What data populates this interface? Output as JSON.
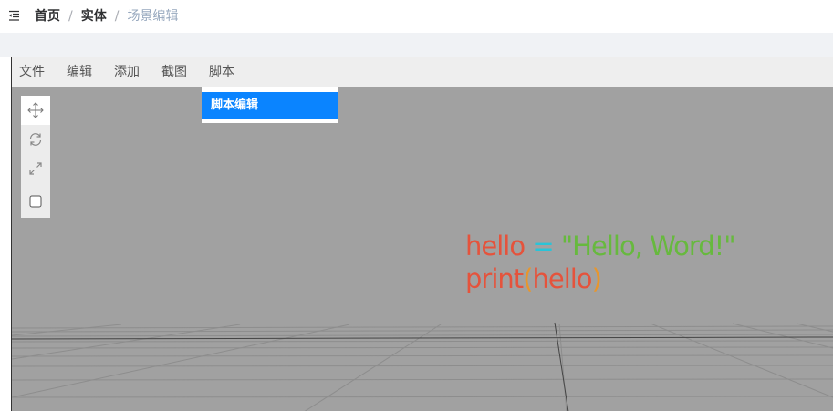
{
  "header": {
    "menu_icon": "outdent-icon",
    "breadcrumb": [
      "首页",
      "实体",
      "场景编辑"
    ],
    "separator": "/"
  },
  "menubar": {
    "items": [
      "文件",
      "编辑",
      "添加",
      "截图",
      "脚本"
    ],
    "open_menu": "脚本",
    "dropdown_items": [
      "脚本编辑"
    ]
  },
  "toolbar": {
    "tools": [
      "move-icon",
      "rotate-icon",
      "scale-icon",
      "checkbox-icon"
    ],
    "active_tool": "move-icon"
  },
  "scene_code": {
    "line1": {
      "var": "hello",
      "op": "=",
      "str": "\"Hello, Word!\""
    },
    "line2": {
      "fn": "print",
      "open": "(",
      "arg": "hello",
      "close": ")"
    }
  },
  "colors": {
    "accent": "#0a84ff",
    "viewport_bg": "#a1a1a1",
    "code_red": "#e5533c",
    "code_cyan": "#29c4d8",
    "code_green": "#67b93e",
    "code_orange": "#e8962c"
  }
}
